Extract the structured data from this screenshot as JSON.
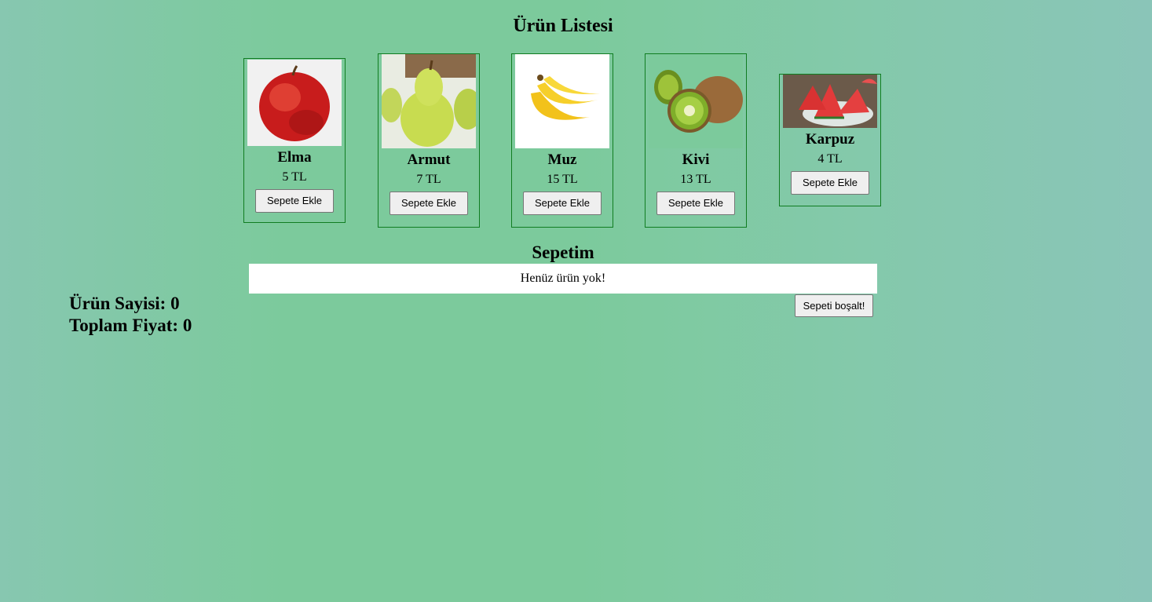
{
  "header": {
    "title": "Ürün Listesi"
  },
  "products": [
    {
      "name": "Elma",
      "price": "5 TL",
      "button": "Sepete Ekle",
      "image": "apple"
    },
    {
      "name": "Armut",
      "price": "7 TL",
      "button": "Sepete Ekle",
      "image": "pear"
    },
    {
      "name": "Muz",
      "price": "15 TL",
      "button": "Sepete Ekle",
      "image": "banana"
    },
    {
      "name": "Kivi",
      "price": "13 TL",
      "button": "Sepete Ekle",
      "image": "kiwi"
    },
    {
      "name": "Karpuz",
      "price": "4 TL",
      "button": "Sepete Ekle",
      "image": "watermelon"
    }
  ],
  "cart": {
    "title": "Sepetim",
    "empty_text": "Henüz ürün yok!",
    "clear_button": "Sepeti boşalt!"
  },
  "summary": {
    "count_text": "Ürün Sayisi: 0",
    "total_text": "Toplam Fiyat: 0"
  },
  "colors": {
    "card_border": "#107d21",
    "background": "#7cca9c"
  }
}
